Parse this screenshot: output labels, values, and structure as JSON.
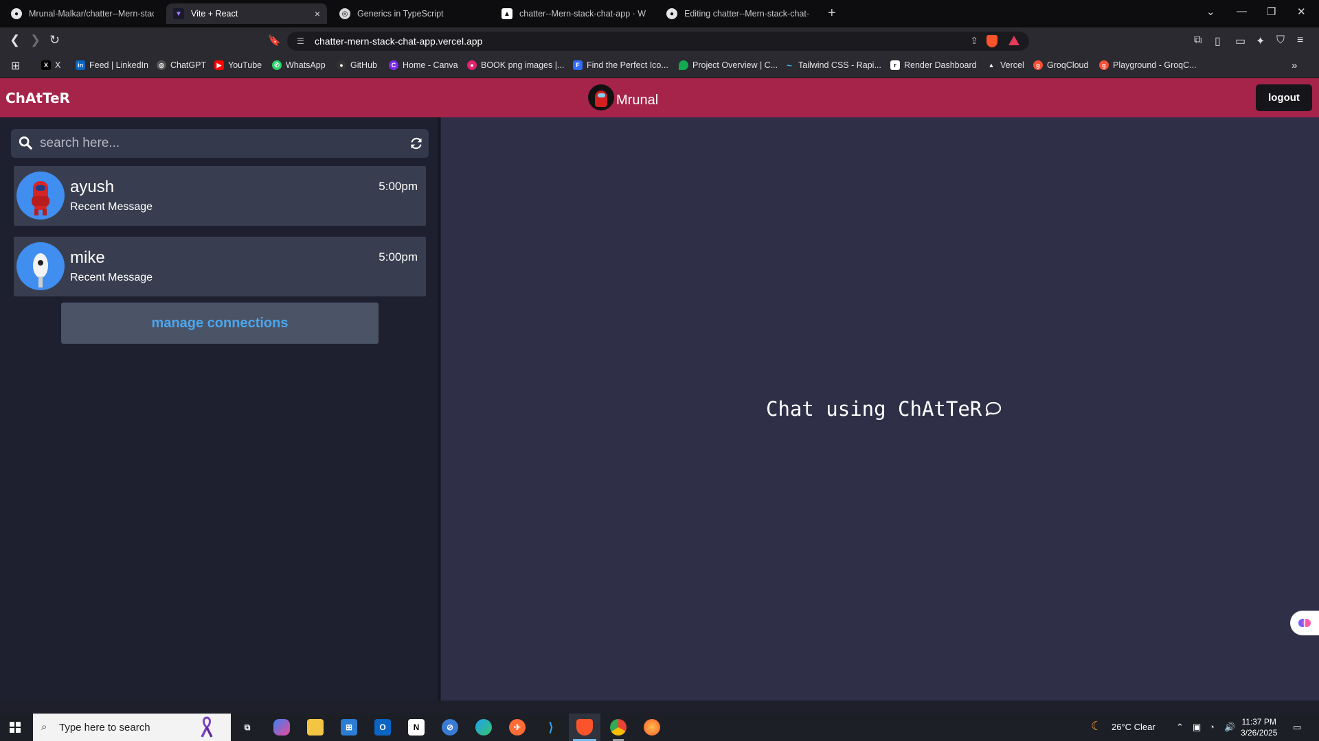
{
  "browser": {
    "tabs": [
      {
        "title": "Mrunal-Malkar/chatter--Mern-stack",
        "icon": "github-icon",
        "active": false
      },
      {
        "title": "Vite + React",
        "icon": "vite-icon",
        "active": true,
        "close": "×"
      },
      {
        "title": "Generics in TypeScript",
        "icon": "chatgpt-icon",
        "active": false
      },
      {
        "title": "chatter--Mern-stack-chat-app · We",
        "icon": "vercel-icon",
        "active": false
      },
      {
        "title": "Editing chatter--Mern-stack-chat-a",
        "icon": "github-icon",
        "active": false
      }
    ],
    "new_tab": "+",
    "address": "chatter-mern-stack-chat-app.vercel.app",
    "bookmarks": [
      {
        "label": "X",
        "icon": "x-icon",
        "color": "#000000"
      },
      {
        "label": "Feed | LinkedIn",
        "icon": "linkedin-icon",
        "color": "#0a66c2"
      },
      {
        "label": "ChatGPT",
        "icon": "chatgpt-icon",
        "color": "#555555"
      },
      {
        "label": "YouTube",
        "icon": "youtube-icon",
        "color": "#ff0000"
      },
      {
        "label": "WhatsApp",
        "icon": "whatsapp-icon",
        "color": "#25d366"
      },
      {
        "label": "GitHub",
        "icon": "github-icon",
        "color": "#333333"
      },
      {
        "label": "Home - Canva",
        "icon": "canva-icon",
        "color": "#7d2ae8"
      },
      {
        "label": "BOOK png images |...",
        "icon": "pngtree-icon",
        "color": "#e0246b"
      },
      {
        "label": "Find the Perfect Ico...",
        "icon": "flaticon-icon",
        "color": "#2f6bff"
      },
      {
        "label": "Project Overview | C...",
        "icon": "mongodb-icon",
        "color": "#13aa52"
      },
      {
        "label": "Tailwind CSS - Rapi...",
        "icon": "tailwind-icon",
        "color": "#38bdf8"
      },
      {
        "label": "Render Dashboard",
        "icon": "render-icon",
        "color": "#ffffff"
      },
      {
        "label": "Vercel",
        "icon": "vercel-icon",
        "color": "#000000"
      },
      {
        "label": "GroqCloud",
        "icon": "groq-icon",
        "color": "#f55036"
      },
      {
        "label": "Playground - GroqC...",
        "icon": "groq-icon",
        "color": "#f55036"
      }
    ]
  },
  "app": {
    "brand": "ChAtTeR",
    "user_name": "Mrunal",
    "logout_label": "logout",
    "accent_color": "#a6234a",
    "search_placeholder": "search here...",
    "contacts": [
      {
        "name": "ayush",
        "time": "5:00pm",
        "message": "Recent Message"
      },
      {
        "name": "mike",
        "time": "5:00pm",
        "message": "Recent Message"
      }
    ],
    "manage_label": "manage connections",
    "welcome_text": "Chat using ChAtTeR"
  },
  "taskbar": {
    "search_placeholder": "Type here to search",
    "apps": [
      "task-view-icon",
      "copilot-icon",
      "file-explorer-icon",
      "microsoft-store-icon",
      "outlook-icon",
      "notion-icon",
      "app-icon",
      "edge-icon",
      "postman-icon",
      "vscode-icon",
      "brave-icon",
      "chrome-icon",
      "firefox-icon"
    ],
    "weather": "26°C  Clear",
    "time": "11:37 PM",
    "date": "3/26/2025"
  }
}
